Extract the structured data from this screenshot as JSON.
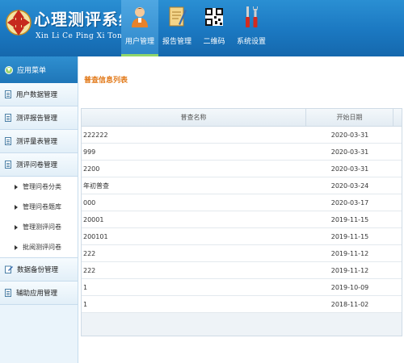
{
  "header": {
    "title": "心理测评系统",
    "subtitle": "Xin Li Ce Ping Xi Tong",
    "nav": [
      {
        "label": "用户管理",
        "icon": "user-icon",
        "active": true
      },
      {
        "label": "报告管理",
        "icon": "report-icon",
        "active": false
      },
      {
        "label": "二维码",
        "icon": "qrcode-icon",
        "active": false
      },
      {
        "label": "系统设置",
        "icon": "tools-icon",
        "active": false
      }
    ]
  },
  "sidebar": {
    "menu_title": "应用菜单",
    "sections": [
      {
        "label": "用户数据管理"
      },
      {
        "label": "测评报告管理"
      },
      {
        "label": "测评量表管理"
      },
      {
        "label": "测评问卷管理"
      },
      {
        "label": "数据备份管理"
      },
      {
        "label": "辅助应用管理"
      }
    ],
    "sub_items": [
      {
        "label": "管理问卷分类"
      },
      {
        "label": "管理问卷题库"
      },
      {
        "label": "管理测评问卷"
      },
      {
        "label": "批阅测评问卷"
      }
    ]
  },
  "main": {
    "title": "普查信息列表",
    "columns": [
      "普查名称",
      "开始日期"
    ],
    "rows": [
      {
        "name": "222222",
        "date": "2020-03-31"
      },
      {
        "name": "999",
        "date": "2020-03-31"
      },
      {
        "name": "2200",
        "date": "2020-03-31"
      },
      {
        "name": "年初普查",
        "date": "2020-03-24"
      },
      {
        "name": "000",
        "date": "2020-03-17"
      },
      {
        "name": "20001",
        "date": "2019-11-15"
      },
      {
        "name": "200101",
        "date": "2019-11-15"
      },
      {
        "name": "222",
        "date": "2019-11-12"
      },
      {
        "name": "222",
        "date": "2019-11-12"
      },
      {
        "name": "1",
        "date": "2019-10-09"
      },
      {
        "name": "1",
        "date": "2018-11-02"
      }
    ]
  },
  "colors": {
    "header_blue": "#1b78c1",
    "active_tab": "#2d86c9",
    "title_orange": "#e27b1c",
    "accent_green": "#8fd56a"
  }
}
